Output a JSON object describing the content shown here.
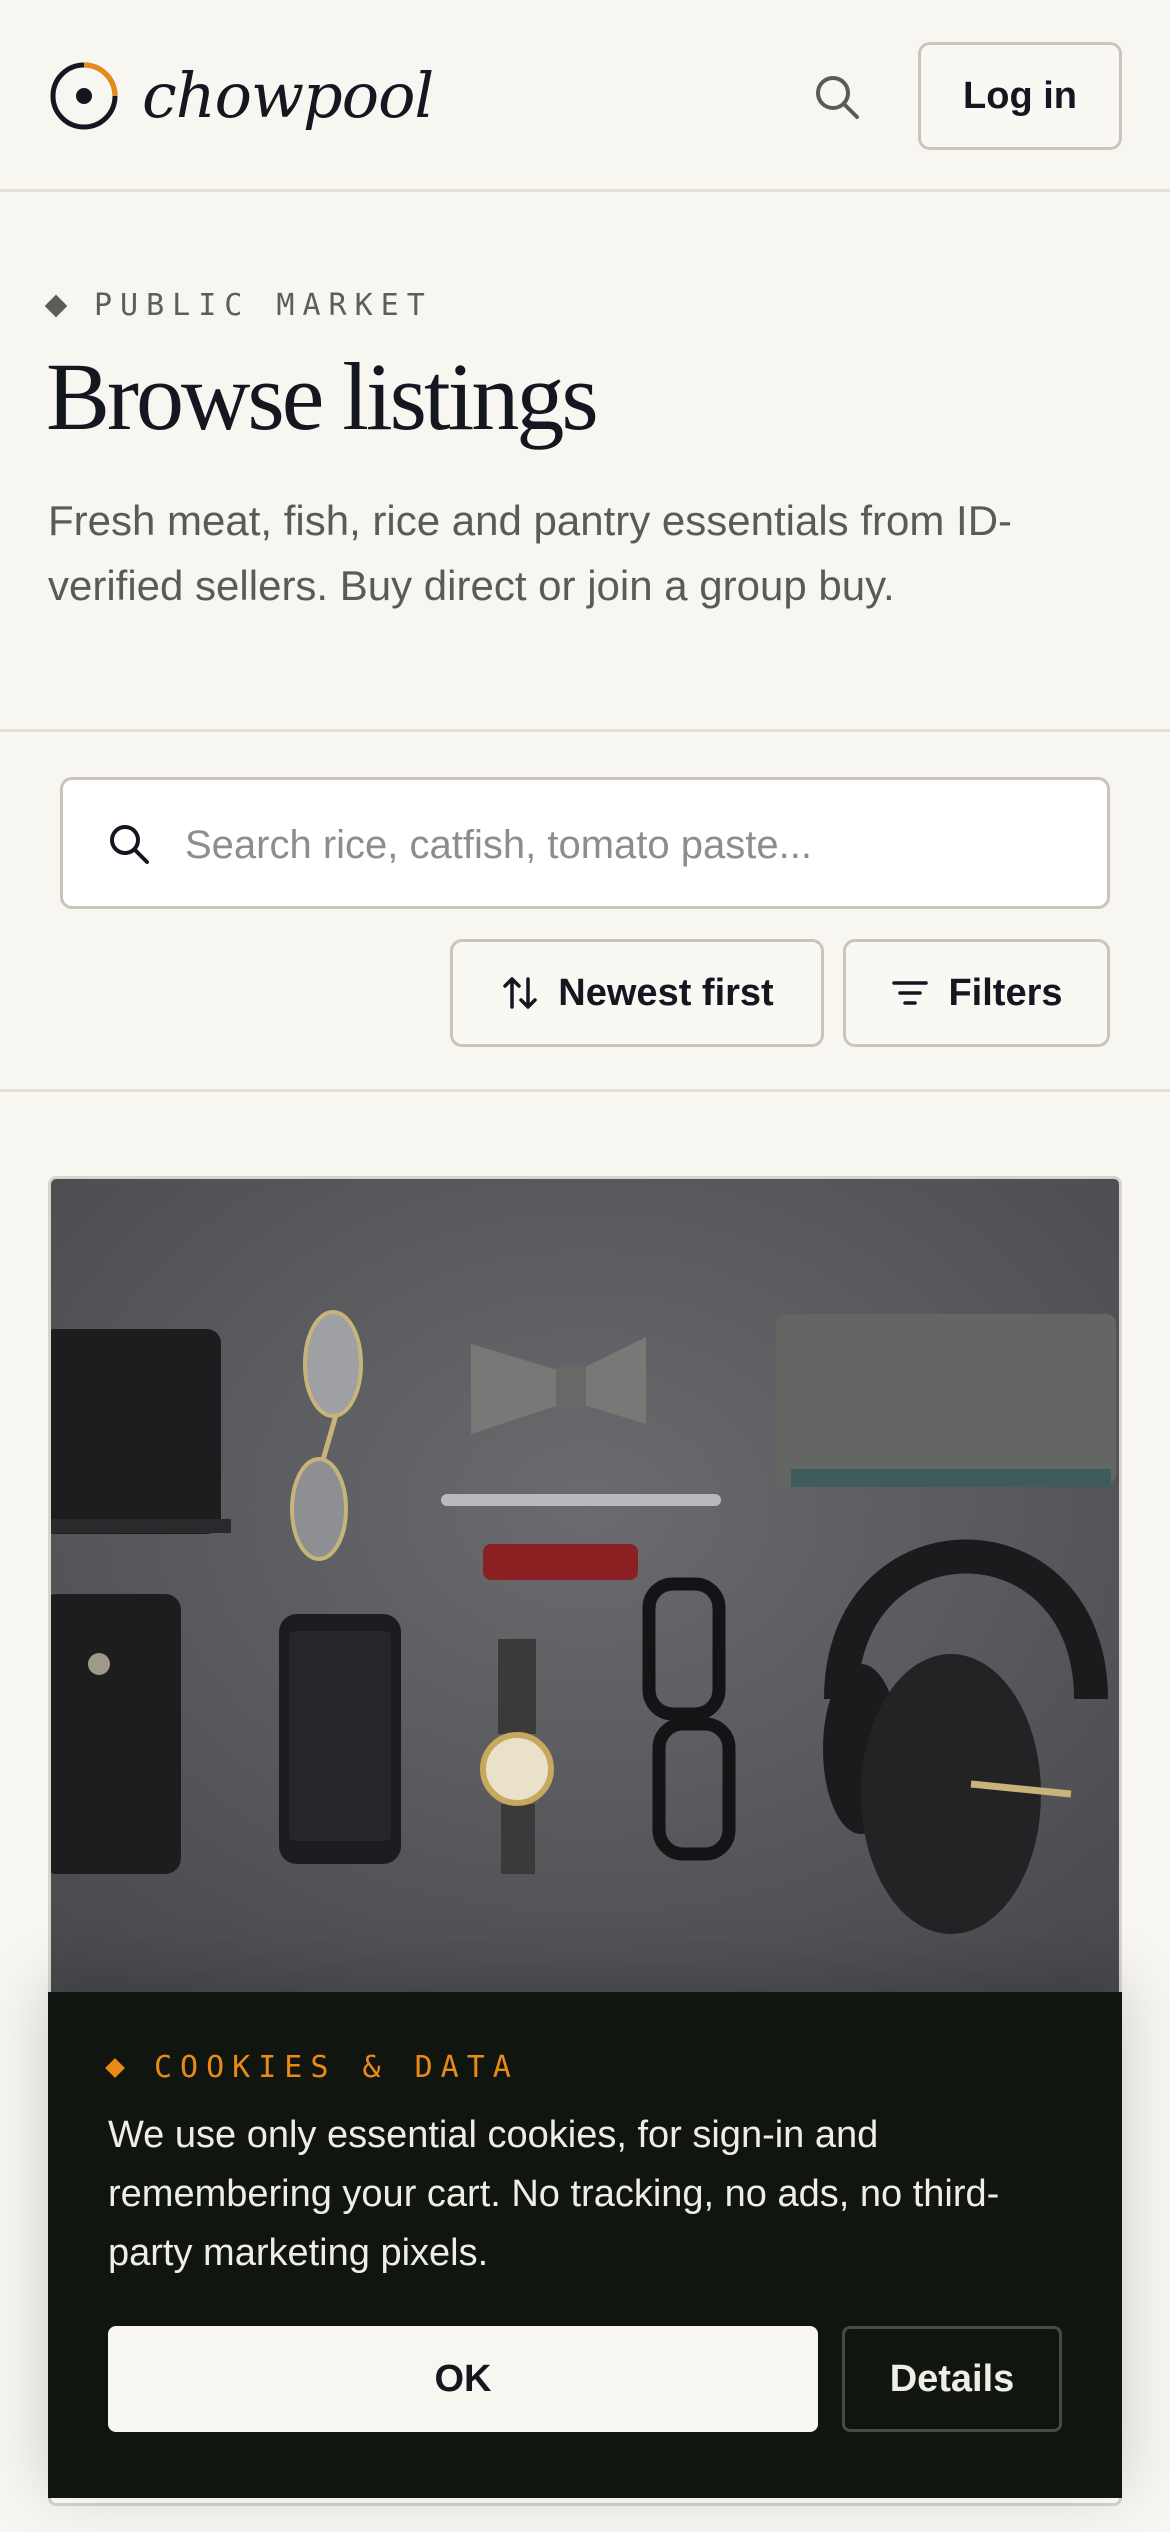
{
  "header": {
    "brand": "chowpool",
    "login_label": "Log in"
  },
  "hero": {
    "eyebrow": "PUBLIC MARKET",
    "title": "Browse listings",
    "subtitle": "Fresh meat, fish, rice and pantry essentials from ID-verified sellers. Buy direct or join a group buy."
  },
  "filters": {
    "search_placeholder": "Search rice, catfish, tomato paste...",
    "search_value": "",
    "sort_label": "Newest first",
    "filters_label": "Filters"
  },
  "cookie": {
    "eyebrow": "COOKIES & DATA",
    "text": "We use only essential cookies, for sign-in and remembering your cart. No tracking, no ads, no third-party marketing pixels.",
    "ok_label": "OK",
    "details_label": "Details"
  },
  "icons": {
    "search": "search-icon",
    "sort": "sort-arrows-icon",
    "filter": "filter-lines-icon",
    "logo": "logo-ring-icon"
  },
  "colors": {
    "background": "#f8f6f0",
    "ink": "#141720",
    "accent": "#e98a16",
    "banner": "#101510"
  }
}
